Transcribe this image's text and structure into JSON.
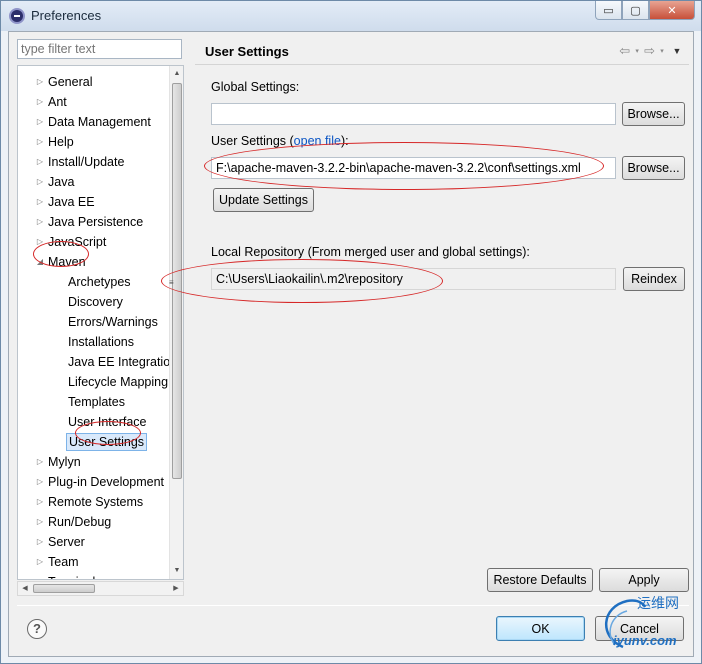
{
  "window": {
    "title": "Preferences"
  },
  "caption": {
    "minimize": "▭",
    "maximize": "▢",
    "close": "✕"
  },
  "filter": {
    "placeholder": "type filter text"
  },
  "tree": {
    "items": [
      {
        "label": "General",
        "expander": "▷"
      },
      {
        "label": "Ant",
        "expander": "▷"
      },
      {
        "label": "Data Management",
        "expander": "▷"
      },
      {
        "label": "Help",
        "expander": "▷"
      },
      {
        "label": "Install/Update",
        "expander": "▷"
      },
      {
        "label": "Java",
        "expander": "▷"
      },
      {
        "label": "Java EE",
        "expander": "▷"
      },
      {
        "label": "Java Persistence",
        "expander": "▷"
      },
      {
        "label": "JavaScript",
        "expander": "▷"
      },
      {
        "label": "Maven",
        "expander": "◢"
      },
      {
        "label": "Archetypes"
      },
      {
        "label": "Discovery"
      },
      {
        "label": "Errors/Warnings"
      },
      {
        "label": "Installations"
      },
      {
        "label": "Java EE Integration"
      },
      {
        "label": "Lifecycle Mapping"
      },
      {
        "label": "Templates"
      },
      {
        "label": "User Interface"
      },
      {
        "label": "User Settings"
      },
      {
        "label": "Mylyn",
        "expander": "▷"
      },
      {
        "label": "Plug-in Development",
        "expander": "▷"
      },
      {
        "label": "Remote Systems",
        "expander": "▷"
      },
      {
        "label": "Run/Debug",
        "expander": "▷"
      },
      {
        "label": "Server",
        "expander": "▷"
      },
      {
        "label": "Team",
        "expander": "▷"
      },
      {
        "label": "Terminal"
      }
    ],
    "scroll_up": "▲",
    "scroll_down": "▼",
    "scroll_left": "◀",
    "scroll_right": "▶",
    "sash": "≡"
  },
  "page": {
    "title": "User Settings",
    "nav": {
      "back": "⇦",
      "forward": "⇨",
      "dropdown": "▾",
      "menu": "▼"
    },
    "global_settings_label": "Global Settings:",
    "global_settings_value": "",
    "browse_label": "Browse...",
    "user_settings_label": "User Settings (",
    "user_settings_link": "open file",
    "user_settings_label_end": "):",
    "user_settings_value": "F:\\apache-maven-3.2.2-bin\\apache-maven-3.2.2\\conf\\settings.xml",
    "update_settings_label": "Update Settings",
    "local_repo_label": "Local Repository (From merged user and global settings):",
    "local_repo_value": "C:\\Users\\Liaokailin\\.m2\\repository",
    "reindex_label": "Reindex",
    "restore_defaults_label": "Restore Defaults",
    "apply_label": "Apply"
  },
  "footer": {
    "help_icon": "?",
    "ok_label": "OK",
    "cancel_label": "Cancel"
  },
  "watermark": {
    "cn": "运维网",
    "url": "iyunv.com"
  },
  "colors": {
    "annotation": "#d62828",
    "link": "#0b55c4",
    "selection": "#d9e9fb"
  }
}
